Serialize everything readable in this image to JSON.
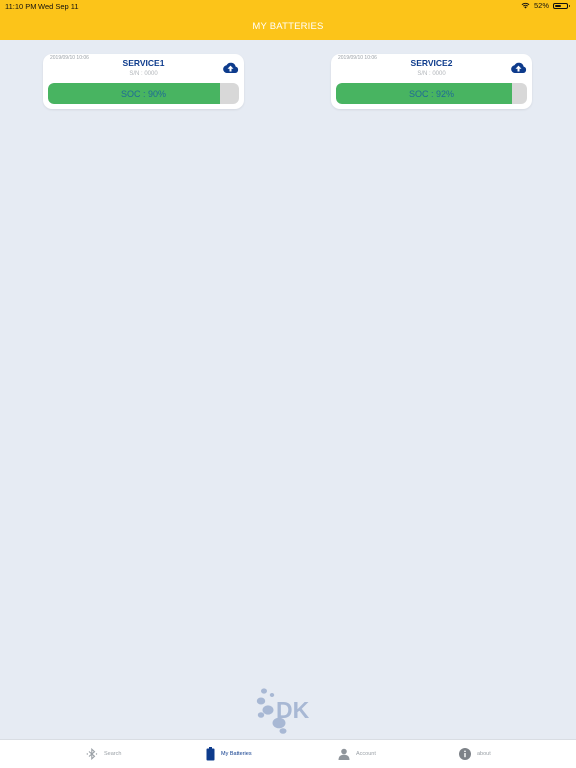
{
  "status_bar": {
    "time": "11:10 PM",
    "date": "Wed Sep 11",
    "battery": "52%",
    "battery_level": 0.52
  },
  "header": {
    "title": "MY BATTERIES"
  },
  "batteries": [
    {
      "timestamp": "2019/09/10 10:06",
      "name": "SERVICE1",
      "serial": "S/N : 0000",
      "soc_label": "SOC : 90%",
      "soc": 0.9
    },
    {
      "timestamp": "2019/09/10 10:06",
      "name": "SERVICE2",
      "serial": "S/N : 0000",
      "soc_label": "SOC : 92%",
      "soc": 0.92
    }
  ],
  "logo": {
    "text": "DK"
  },
  "tabs": [
    {
      "label": "Search",
      "icon": "bluetooth-icon",
      "active": false
    },
    {
      "label": "My Batteries",
      "icon": "battery-icon",
      "active": true
    },
    {
      "label": "Account",
      "icon": "person-icon",
      "active": false
    },
    {
      "label": "about",
      "icon": "info-icon",
      "active": false
    }
  ],
  "colors": {
    "header": "#fcc419",
    "background": "#e6ebf3",
    "accent": "#0d3b8c",
    "soc_fill": "#48b461",
    "soc_track": "#d8d8d8",
    "soc_text": "#1f6a96",
    "logo": "#a8b8d4"
  }
}
